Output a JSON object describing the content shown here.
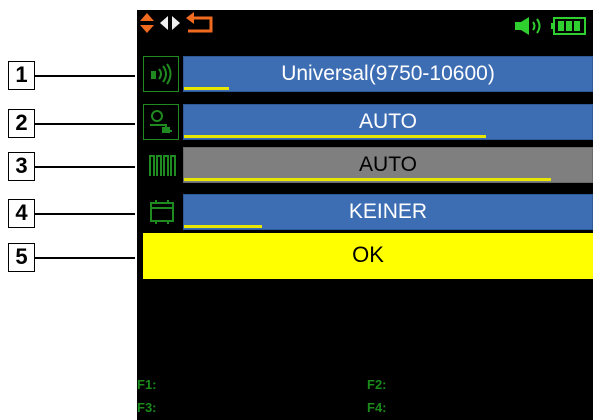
{
  "callouts": [
    {
      "label": "1"
    },
    {
      "label": "2"
    },
    {
      "label": "3"
    },
    {
      "label": "4"
    },
    {
      "label": "5"
    }
  ],
  "status_bar": {
    "nav_icons": [
      "up-down-arrows-icon",
      "left-right-arrows-icon",
      "back-arrow-icon"
    ],
    "status_icons": [
      "speaker-icon",
      "battery-icon"
    ],
    "colors": {
      "nav": "#f06a1f",
      "status": "#2fcf2f"
    }
  },
  "settings": [
    {
      "icon": "lnb-signal-icon",
      "value": "Universal(9750-10600)",
      "style": "blue",
      "progress": 0.11
    },
    {
      "icon": "diseqc-switch-icon",
      "value": "AUTO",
      "style": "blue",
      "progress": 0.74
    },
    {
      "icon": "modulation-icon",
      "value": "AUTO",
      "style": "gray",
      "progress": 0.9
    },
    {
      "icon": "screen-module-icon",
      "value": "KEINER",
      "style": "blue",
      "progress": 0.19
    }
  ],
  "ok_button": {
    "label": "OK"
  },
  "function_keys": {
    "f1": "F1:",
    "f2": "F2:",
    "f3": "F3:",
    "f4": "F4:"
  },
  "colors": {
    "field_blue": "#3d6db3",
    "field_gray": "#7f7f7f",
    "ok_yellow": "#ffff00",
    "icon_green": "#1f8a1f",
    "fkey_green": "#1a8a1a"
  }
}
